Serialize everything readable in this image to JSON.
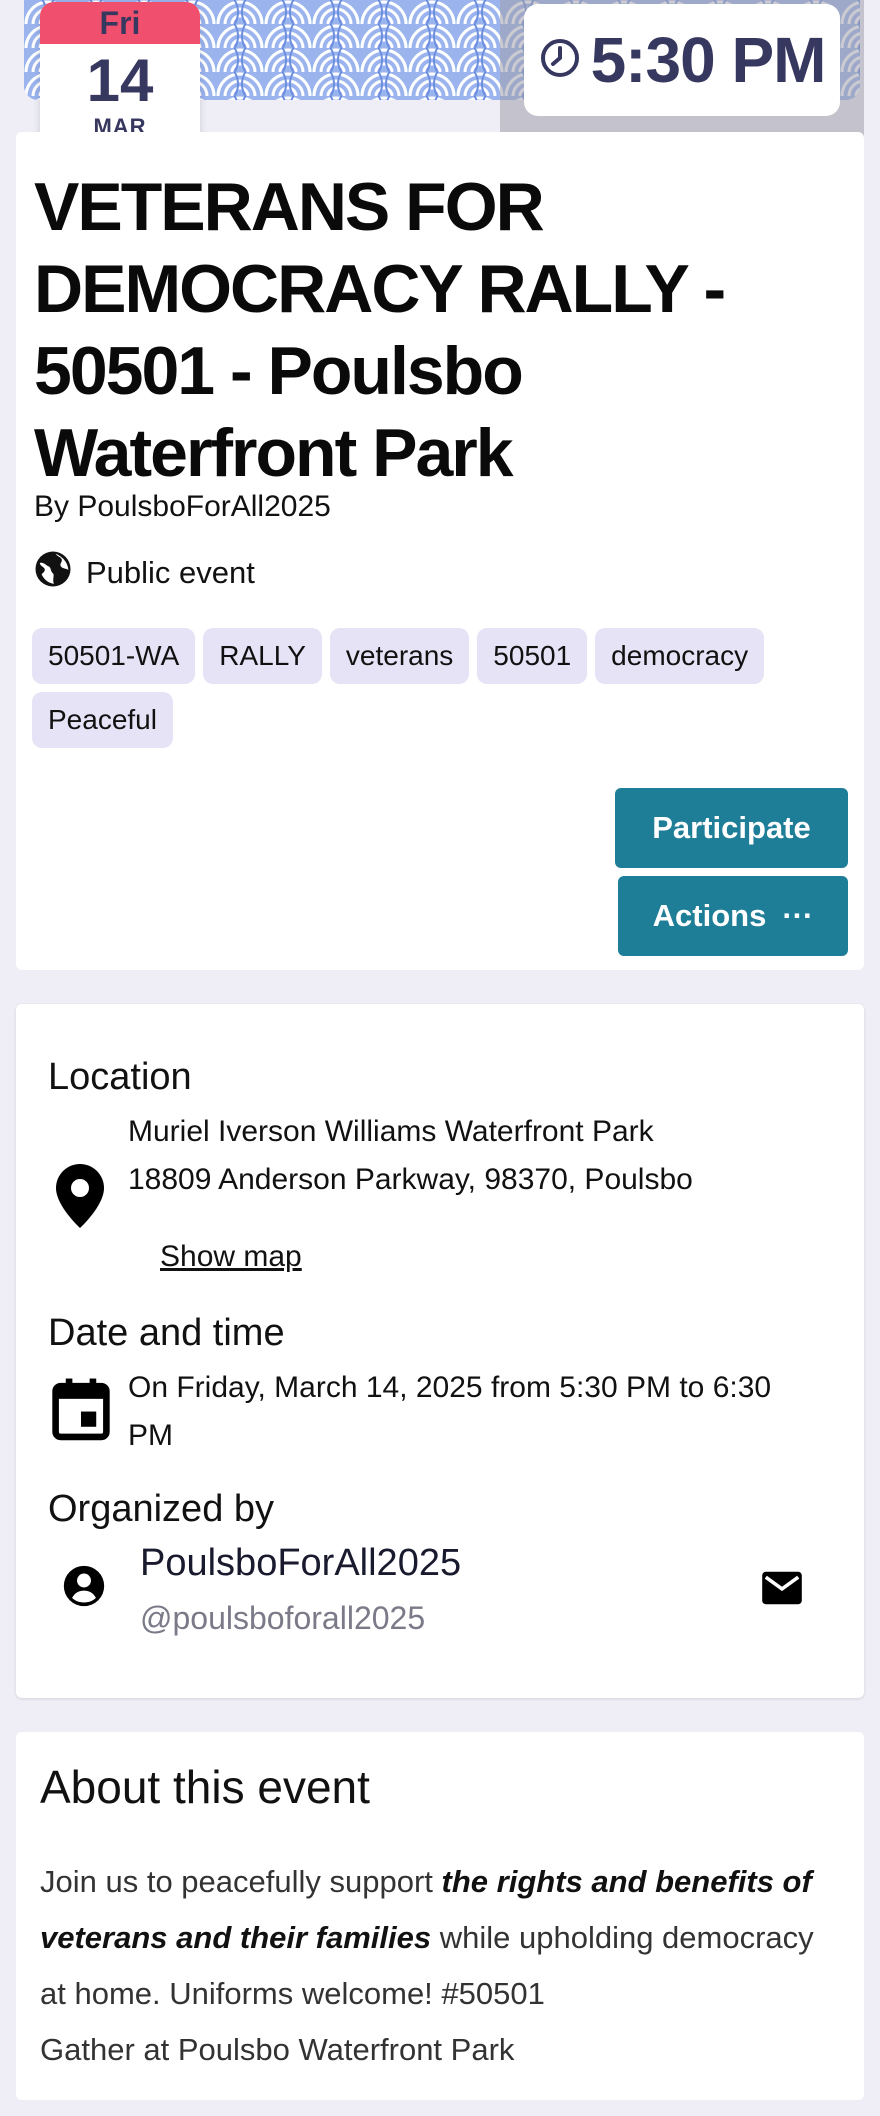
{
  "banner": {
    "day_of_week": "Fri",
    "day": "14",
    "month": "MAR",
    "time": "5:30 PM",
    "pattern_colors": [
      "#9bb4ee",
      "#ffffff",
      "#6d8ee0"
    ]
  },
  "event": {
    "title": "VETERANS FOR DEMOCRACY RALLY - 50501 - Poulsbo Waterfront Park",
    "organizer_line": "By PoulsboForAll2025",
    "visibility": "Public event",
    "tags": [
      "50501-WA",
      "RALLY",
      "veterans",
      "50501",
      "democracy",
      "Peaceful"
    ],
    "participate_label": "Participate",
    "actions_label": "Actions",
    "actions_more": "···"
  },
  "details": {
    "location_label": "Location",
    "location_name": "Muriel Iverson Williams Waterfront Park",
    "location_address": "18809 Anderson Parkway, 98370, Poulsbo",
    "show_map": "Show map",
    "datetime_label": "Date and time",
    "datetime_line1": "On Friday, March 14, 2025 from 5:30 PM to 6:30",
    "datetime_line2": "PM",
    "organized_label": "Organized by",
    "organizer_name": "PoulsboForAll2025",
    "organizer_handle": "@poulsboforall2025"
  },
  "about": {
    "title": "About this event",
    "text_before": "Join us to peacefully support ",
    "text_bold": "the rights and benefits of veterans and their families",
    "text_after": " while upholding democracy at home. Uniforms welcome! #50501",
    "text_line2": "Gather at Poulsbo Waterfront Park"
  },
  "colors": {
    "accent": "#1e7d97",
    "badge_red": "#f0506e",
    "badge_text": "#37385f",
    "tag_bg": "#e5e3f5",
    "page_bg": "#efeef6"
  }
}
